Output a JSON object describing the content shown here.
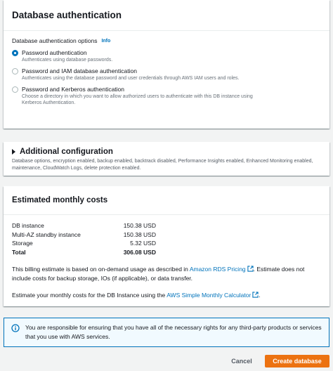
{
  "auth": {
    "title": "Database authentication",
    "options_label": "Database authentication options",
    "info_label": "Info",
    "options": [
      {
        "title": "Password authentication",
        "description": "Authenticates using database passwords.",
        "selected": true
      },
      {
        "title": "Password and IAM database authentication",
        "description": "Authenticates using the database password and user credentials through AWS IAM users and roles.",
        "selected": false
      },
      {
        "title": "Password and Kerberos authentication",
        "description": "Choose a directory in which you want to allow authorized users to authenticate with this DB instance using Kerberos Authentication.",
        "selected": false
      }
    ]
  },
  "additional": {
    "title": "Additional configuration",
    "description": "Database options, encryption enabled, backup enabled, backtrack disabled, Performance Insights enabled, Enhanced Monitoring enabled, maintenance, CloudWatch Logs, delete protection enabled."
  },
  "costs": {
    "title": "Estimated monthly costs",
    "rows": [
      {
        "label": "DB instance",
        "value": "150.38 USD"
      },
      {
        "label": "Multi-AZ standby instance",
        "value": "150.38 USD"
      },
      {
        "label": "Storage",
        "value": "5.32 USD"
      },
      {
        "label": "Total",
        "value": "306.08 USD"
      }
    ],
    "estimate_text_1": "This billing estimate is based on on-demand usage as described in",
    "pricing_link": "Amazon RDS Pricing",
    "estimate_text_2": ". Estimate does not include costs for backup storage, IOs (if applicable), or data transfer.",
    "calculator_text_1": "Estimate your monthly costs for the DB Instance using the",
    "calculator_link": "AWS Simple Monthly Calculator",
    "calculator_text_2": "."
  },
  "notice": {
    "text": "You are responsible for ensuring that you have all of the necessary rights for any third-party products or services that you use with AWS services."
  },
  "footer": {
    "cancel_label": "Cancel",
    "create_label": "Create database"
  },
  "colors": {
    "link": "#0073bb",
    "primary_button": "#ec7211",
    "notice_bg": "#f1faff"
  },
  "icons": {
    "external_link": "external-link-icon",
    "info": "info-icon",
    "expand": "caret-right-icon"
  }
}
